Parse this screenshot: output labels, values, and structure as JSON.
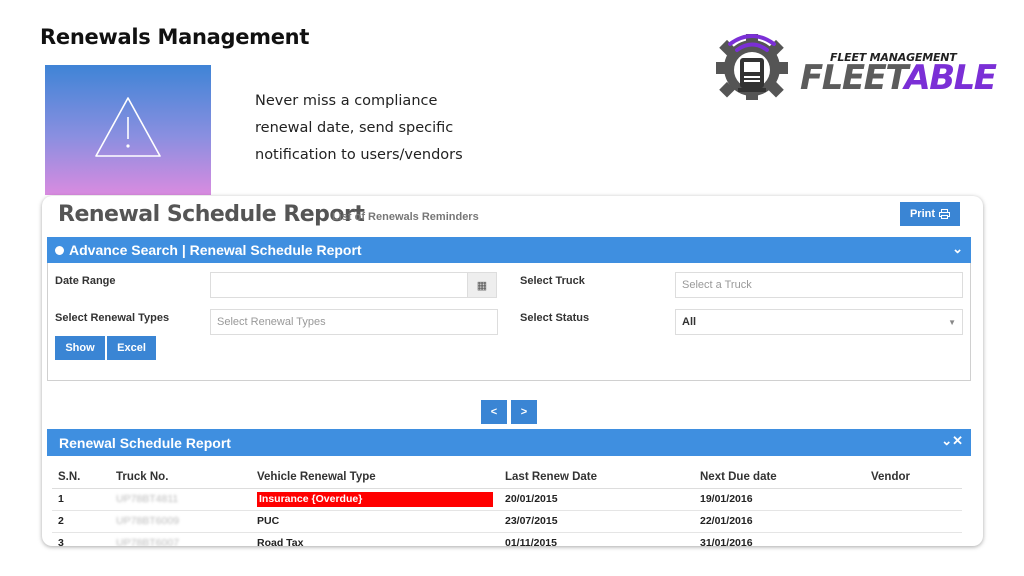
{
  "slide": {
    "title": "Renewals Management",
    "blurb": [
      "Never miss a compliance",
      "renewal date, send specific",
      "notification to users/vendors"
    ],
    "icon": "warning-triangle-icon",
    "gradient": [
      "#3f84d6",
      "#d98be0"
    ]
  },
  "logo": {
    "sub": "FLEET MANAGEMENT",
    "main_a": "FLEET",
    "main_b": "ABLE",
    "accent": "#7b2fd6"
  },
  "report": {
    "title": "Renewal Schedule Report",
    "subtitle": "List of Renewals Reminders",
    "print_label": "Print",
    "search_header": "Advance Search | Renewal Schedule Report",
    "labels": {
      "date_range": "Date Range",
      "select_truck": "Select Truck",
      "renewal_types": "Select Renewal Types",
      "select_status": "Select Status"
    },
    "inputs": {
      "date_range_value": "",
      "truck_placeholder": "Select a Truck",
      "renewal_types_placeholder": "Select Renewal Types",
      "status_value": "All"
    },
    "buttons": {
      "show": "Show",
      "excel": "Excel",
      "prev": "<",
      "next": ">"
    },
    "table_header": "Renewal Schedule Report",
    "columns": [
      "S.N.",
      "Truck No.",
      "Vehicle Renewal Type",
      "Last Renew Date",
      "Next Due date",
      "Vendor"
    ],
    "rows": [
      {
        "sn": "1",
        "truck": "UP78BT4811",
        "type": "Insurance {Overdue}",
        "last": "20/01/2015",
        "next": "19/01/2016",
        "vendor": "",
        "overdue": true
      },
      {
        "sn": "2",
        "truck": "UP78BT6009",
        "type": "PUC",
        "last": "23/07/2015",
        "next": "22/01/2016",
        "vendor": ""
      },
      {
        "sn": "3",
        "truck": "UP78BT6007",
        "type": "Road Tax",
        "last": "01/11/2015",
        "next": "31/01/2016",
        "vendor": ""
      }
    ],
    "accent": "#3f8fe0",
    "overdue_color": "#ff0000"
  }
}
